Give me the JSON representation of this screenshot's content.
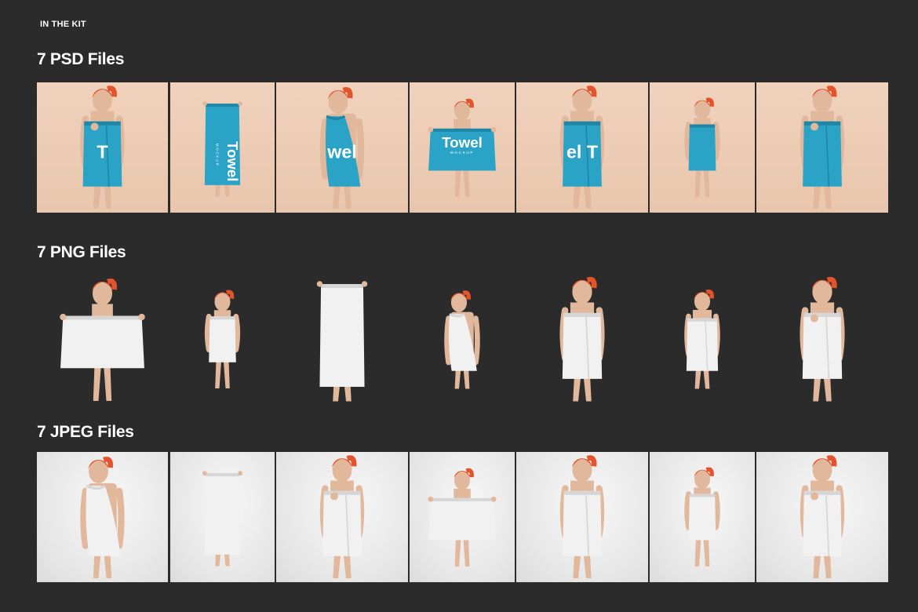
{
  "header": {
    "kit_label": "IN THE KIT"
  },
  "colors": {
    "background": "#2b2b2b",
    "psd_tile": "#eecfb9",
    "jpeg_tile": "#ececec",
    "towel_blue": "#2aa3c7",
    "towel_white": "#f1f1f1",
    "hair": "#e4542c",
    "skin": "#e2b89c"
  },
  "sections": [
    {
      "title": "7 PSD Files",
      "variant": "psd",
      "items": [
        {
          "pose": "wrap-lean",
          "towel": "blue",
          "print": "T"
        },
        {
          "pose": "hanging",
          "towel": "blue",
          "print": "Towel",
          "sub": "MOCKUP"
        },
        {
          "pose": "shoulder",
          "towel": "blue",
          "print": "wel"
        },
        {
          "pose": "hold-front",
          "towel": "blue",
          "print": "Towel",
          "sub": "MOCKUP"
        },
        {
          "pose": "wrap",
          "towel": "blue",
          "print": "el T"
        },
        {
          "pose": "wrap-walk",
          "towel": "blue",
          "print": ""
        },
        {
          "pose": "wrap-lean",
          "towel": "blue",
          "print": ""
        }
      ]
    },
    {
      "title": "7 PNG Files",
      "variant": "png",
      "items": [
        {
          "pose": "hold-front",
          "towel": "white"
        },
        {
          "pose": "wrap-walk",
          "towel": "white"
        },
        {
          "pose": "hanging",
          "towel": "white"
        },
        {
          "pose": "shoulder",
          "towel": "white"
        },
        {
          "pose": "wrap",
          "towel": "white"
        },
        {
          "pose": "wrap",
          "towel": "white"
        },
        {
          "pose": "wrap-lean",
          "towel": "white"
        }
      ]
    },
    {
      "title": "7 JPEG Files",
      "variant": "jpg",
      "items": [
        {
          "pose": "shoulder",
          "towel": "white"
        },
        {
          "pose": "hanging",
          "towel": "white"
        },
        {
          "pose": "wrap-lean",
          "towel": "white"
        },
        {
          "pose": "hold-front",
          "towel": "white"
        },
        {
          "pose": "wrap",
          "towel": "white"
        },
        {
          "pose": "wrap-walk",
          "towel": "white"
        },
        {
          "pose": "wrap-lean",
          "towel": "white"
        }
      ]
    }
  ]
}
